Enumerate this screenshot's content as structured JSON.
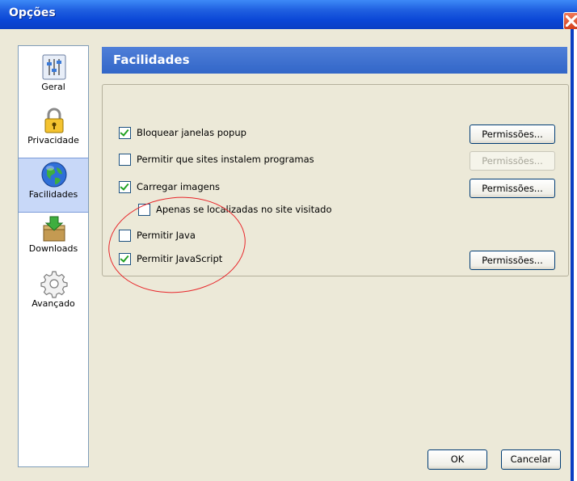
{
  "window": {
    "title": "Opções"
  },
  "sidebar": {
    "items": [
      {
        "label": "Geral",
        "icon": "general-icon"
      },
      {
        "label": "Privacidade",
        "icon": "lock-icon"
      },
      {
        "label": "Facilidades",
        "icon": "globe-icon",
        "selected": true
      },
      {
        "label": "Downloads",
        "icon": "download-box-icon"
      },
      {
        "label": "Avançado",
        "icon": "gear-icon"
      }
    ]
  },
  "header": {
    "title": "Facilidades"
  },
  "options": [
    {
      "label": "Bloquear janelas popup",
      "checked": true,
      "button": "Permissões..."
    },
    {
      "label": "Permitir que sites instalem programas",
      "checked": false,
      "button": "Permissões...",
      "button_disabled": true
    },
    {
      "label": "Carregar imagens",
      "checked": true,
      "button": "Permissões..."
    },
    {
      "label": "Apenas se localizadas no site visitado",
      "checked": false
    },
    {
      "label": "Permitir Java",
      "checked": false
    },
    {
      "label": "Permitir JavaScript",
      "checked": true,
      "button": "Permissões..."
    }
  ],
  "footer": {
    "ok_label": "OK",
    "cancel_label": "Cancelar"
  },
  "colors": {
    "titlebar": "#0a46d6",
    "header": "#3266c8",
    "annotation": "#e8262a"
  }
}
